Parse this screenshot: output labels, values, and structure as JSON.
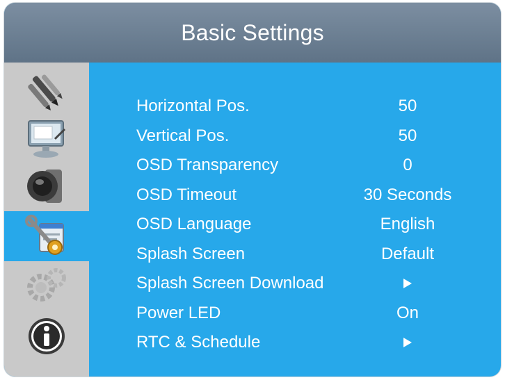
{
  "header": {
    "title": "Basic Settings"
  },
  "sidebar": {
    "items": [
      {
        "icon": "pens-icon"
      },
      {
        "icon": "monitor-icon"
      },
      {
        "icon": "speaker-icon"
      },
      {
        "icon": "tools-icon",
        "active": true
      },
      {
        "icon": "gears-icon"
      },
      {
        "icon": "info-icon"
      }
    ]
  },
  "menu": {
    "rows": [
      {
        "label": "Horizontal Pos.",
        "value": "50"
      },
      {
        "label": "Vertical Pos.",
        "value": "50"
      },
      {
        "label": "OSD Transparency",
        "value": "0"
      },
      {
        "label": "OSD Timeout",
        "value": "30 Seconds"
      },
      {
        "label": "OSD Language",
        "value": "English"
      },
      {
        "label": "Splash Screen",
        "value": "Default"
      },
      {
        "label": "Splash Screen Download",
        "value": ""
      },
      {
        "label": "Power LED",
        "value": "On"
      },
      {
        "label": "RTC & Schedule",
        "value": ""
      }
    ]
  },
  "colors": {
    "accent": "#27a8ea",
    "header": "#6b7f93",
    "sidebar": "#c9c9c9"
  }
}
